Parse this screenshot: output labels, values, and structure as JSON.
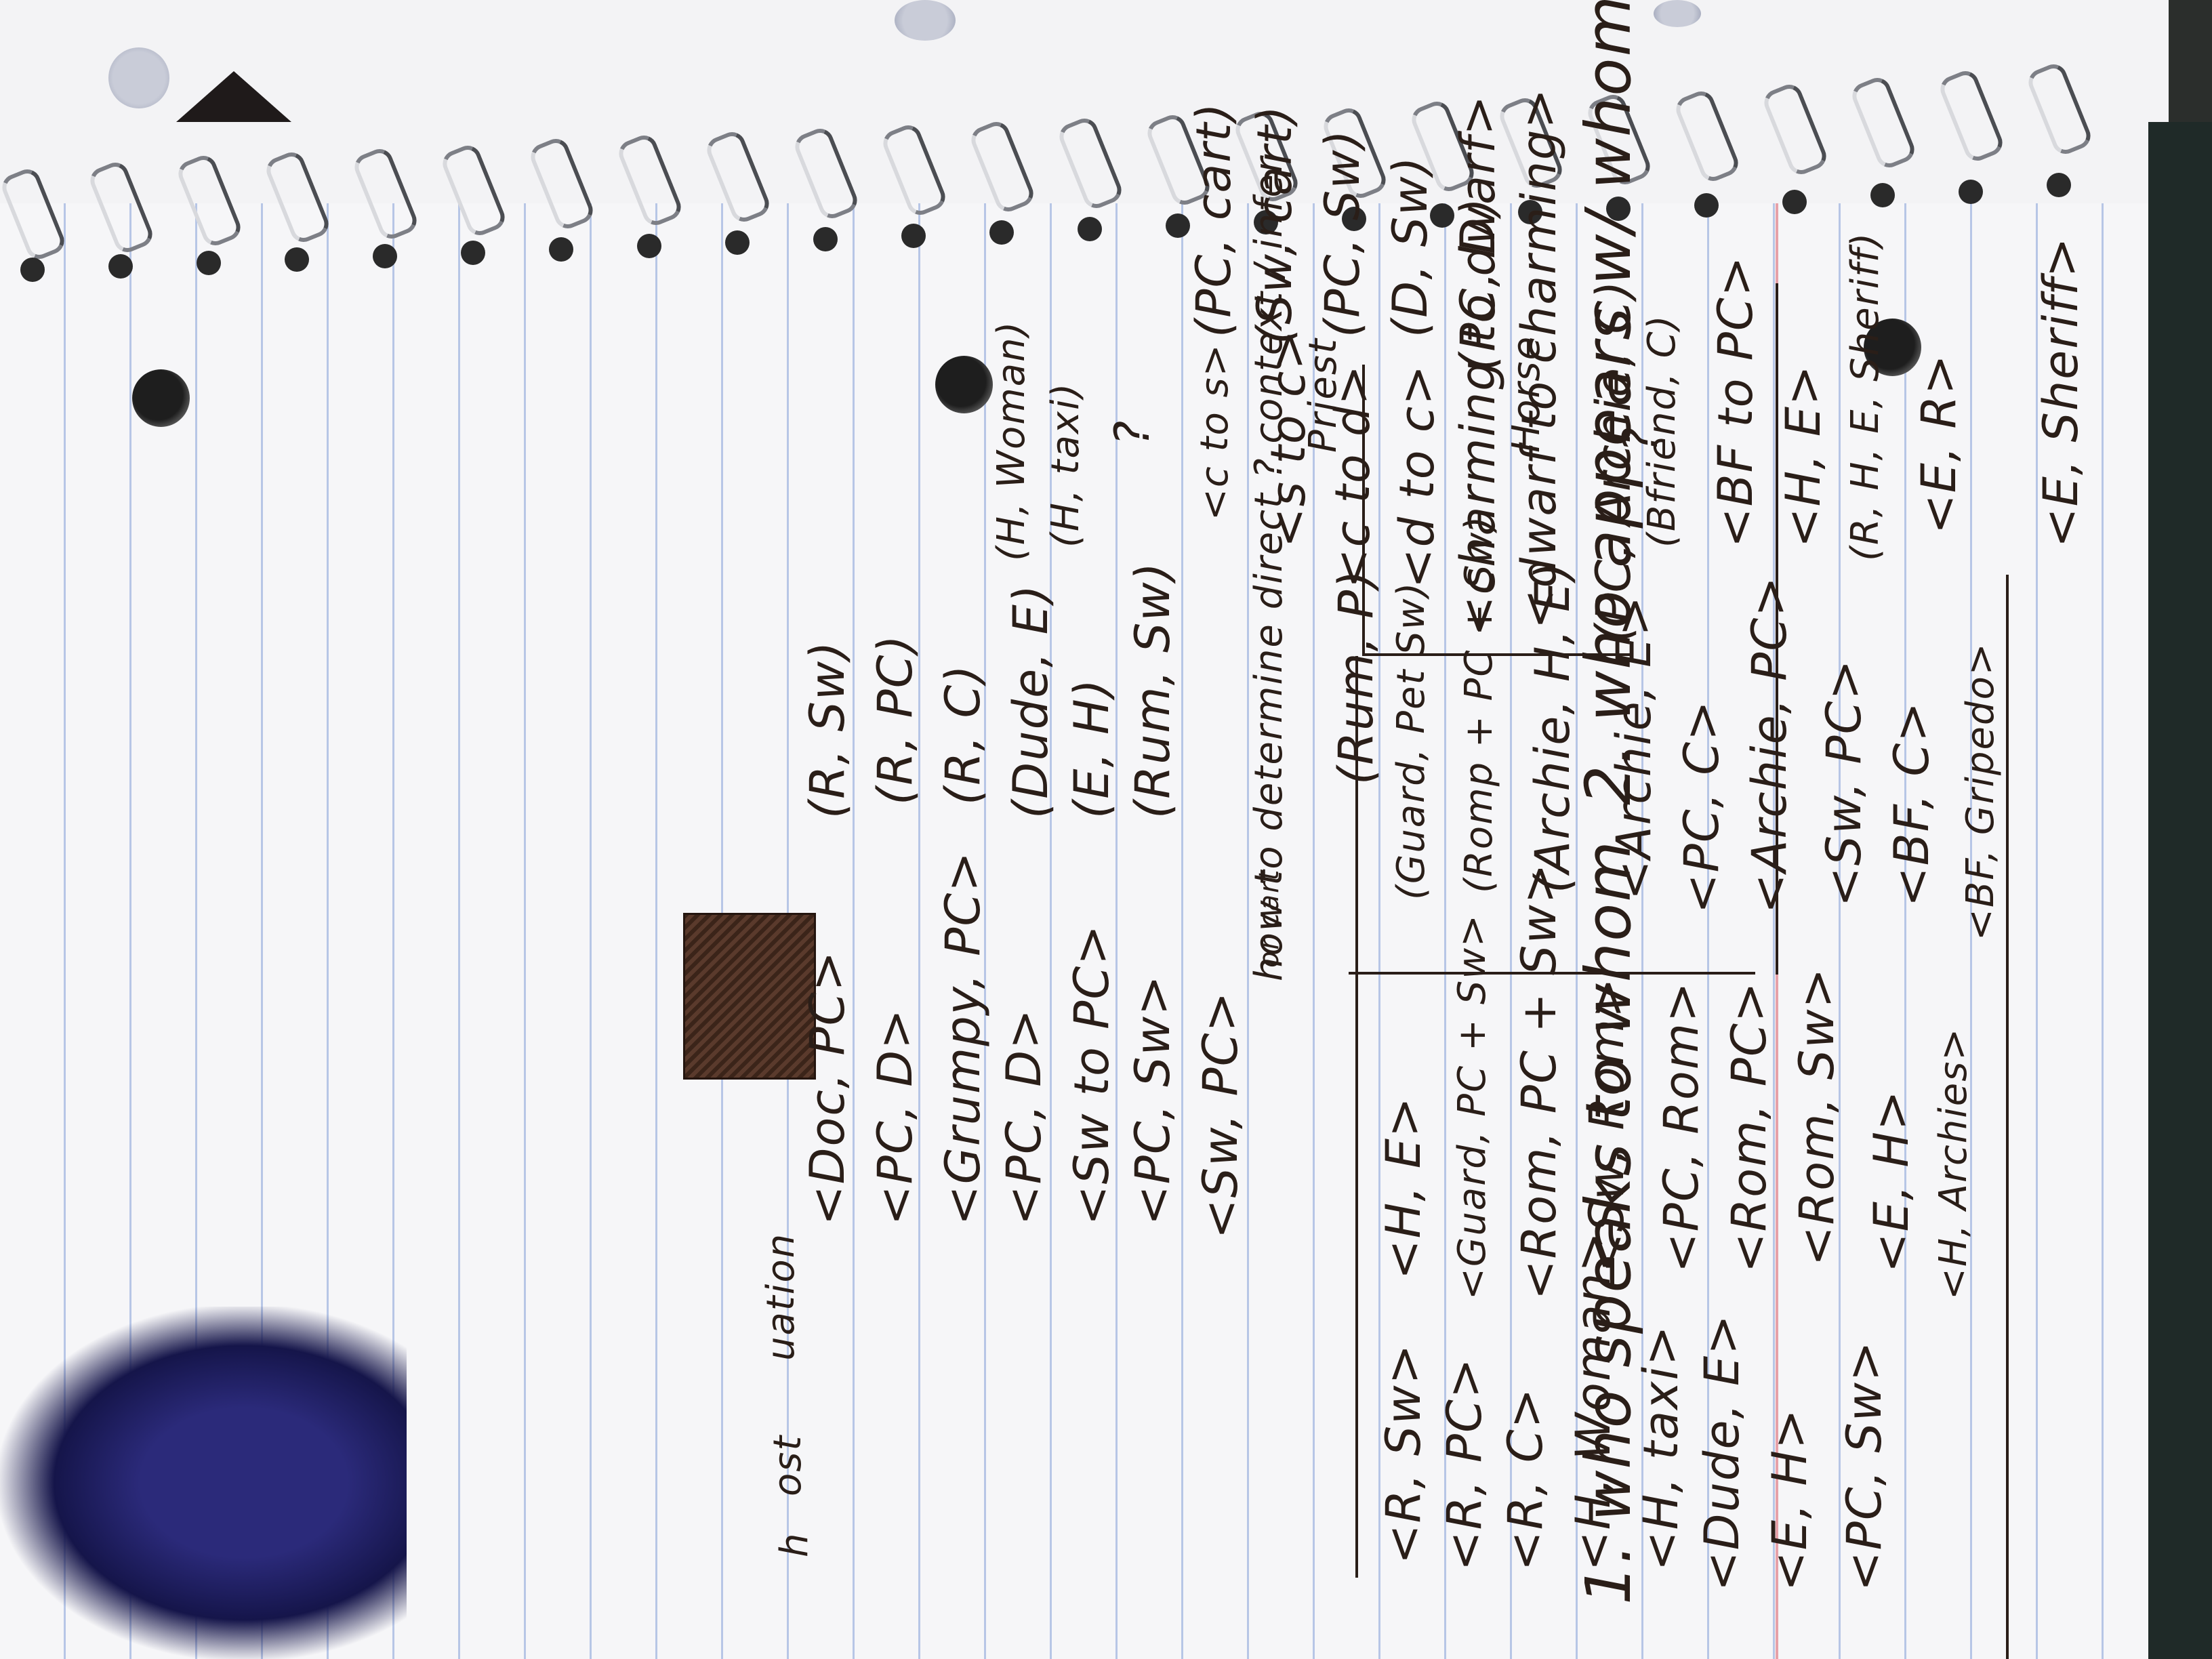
{
  "heading": {
    "q1": "1. who speaks to whom",
    "q2": "2. who appears w/ whom",
    "q": "?",
    "q_mark": "?"
  },
  "speaks_to": [
    "<dwarf to charming>",
    "<charming to dwarf>",
    "<d to c>",
    "<c to d>",
    "<s to c>",
    "<c to s>"
  ],
  "appears_with": [
    "(PC, D)",
    "(D, Sw)",
    "(PC, Sw)",
    "(Sw, cart)",
    "(PC, cart)"
  ],
  "side_notes": [
    "Horse",
    "Priest"
  ],
  "left_col": [
    "<Doc, PC>",
    "<PC, D>",
    "<Grumpy, PC>",
    "<PC, D>",
    "<Sw to PC>",
    "<PC, Sw>",
    "<Sw, PC>"
  ],
  "or_cart": "or cart",
  "right_col": [
    "(R, Sw)",
    "(R, PC)",
    "(R, C)",
    "(Dude, E)",
    "(E, H)",
    "(Rum, Sw)",
    "(Rum, P)"
  ],
  "right_notes": [
    "(H, Woman)",
    "(H, taxi)"
  ],
  "context_line": "how to determine direct ? context / infer",
  "grid_rows": [
    [
      "<R, Sw>",
      "<H, E>",
      "(Guard, Pet Sw)",
      "(PC, Archie, C)"
    ],
    [
      "<R, PC>",
      "<Guard, PC + Sw>",
      "(Romp + PC + Sw)",
      "(Bfriend, C)"
    ],
    [
      "<R, C>",
      "<Rom, PC + Sw>",
      "(Archie, H, E)",
      "<BF to PC>"
    ],
    [
      "<H, Woman>",
      "<Sw, Rom>",
      "<Archie, E>",
      "<H, E>"
    ],
    [
      "<H, taxi>",
      "<PC, Rom>",
      "<PC, C>",
      "(R, H, E, Sheriff)"
    ],
    [
      "<Dude, E>",
      "<Rom, PC>",
      "<Archie, PC>",
      "<E, R>"
    ],
    [
      "<E, H>",
      "<Rom, Sw>",
      "<Sw, PC>",
      "<E, Sheriff>"
    ],
    [
      "<PC, Sw>",
      "<E, H>",
      "<BF, C>",
      ""
    ],
    [
      "",
      "<H, Archies>",
      "<BF, Gripedo>",
      ""
    ]
  ],
  "margin_words": [
    "uation",
    "ost",
    "h"
  ]
}
